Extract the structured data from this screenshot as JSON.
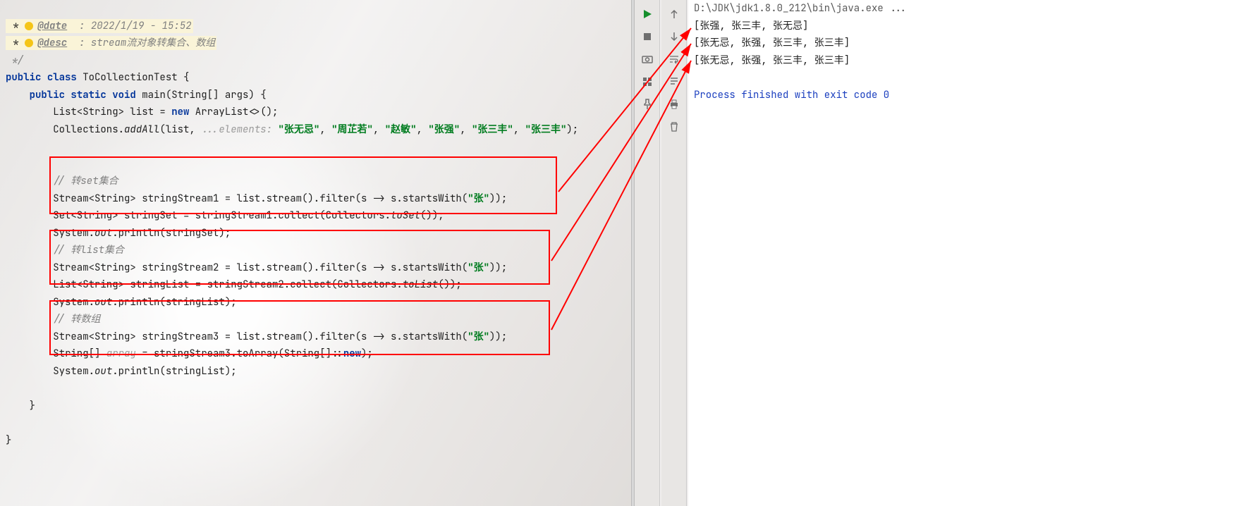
{
  "javadoc": {
    "date_tag": "@date",
    "date_val": ": 2022/1/19 - 15:52",
    "desc_tag": "@desc",
    "desc_val": ": stream流对象转集合、数组",
    "end": "*/"
  },
  "code": {
    "l1": {
      "kw1": "public",
      "kw2": "class",
      "name": "ToCollectionTest {"
    },
    "l2": {
      "kw1": "public",
      "kw2": "static",
      "kw3": "void",
      "sig": "main(String[] args) {"
    },
    "l3": {
      "a": "List<String> list = ",
      "kw": "new",
      "b": " ArrayList<>();"
    },
    "l4": {
      "a": "Collections.",
      "m": "addAll",
      "b": "(list, ",
      "hint": "...elements: ",
      "s1": "\"张无忌\"",
      "s2": "\"周芷若\"",
      "s3": "\"赵敏\"",
      "s4": "\"张强\"",
      "s5": "\"张三丰\"",
      "s6": "\"张三丰\"",
      "end": ");"
    },
    "c1": "// 转set集合",
    "l5": {
      "a": "Stream<String> stringStream1 = list.stream().filter(s -> s.startsWith(",
      "s": "\"张\"",
      "b": "));"
    },
    "l6": {
      "a": "Set<String> stringSet = stringStream1.collect(Collectors.",
      "m": "toSet",
      "b": "());"
    },
    "l7": {
      "a": "System.",
      "f": "out",
      "b": ".println(stringSet);"
    },
    "c2": "// 转list集合",
    "l8": {
      "a": "Stream<String> stringStream2 = list.stream().filter(s -> s.startsWith(",
      "s": "\"张\"",
      "b": "));"
    },
    "l9": {
      "a": "List<String> stringList = stringStream2.collect(Collectors.",
      "m": "toList",
      "b": "());"
    },
    "l10": {
      "a": "System.",
      "f": "out",
      "b": ".println(stringList);"
    },
    "c3": "// 转数组",
    "l11": {
      "a": "Stream<String> stringStream3 = list.stream().filter(s -> s.startsWith(",
      "s": "\"张\"",
      "b": "));"
    },
    "l12": {
      "a": "String[] ",
      "h": "array",
      "b": " = stringStream3.toArray(String[]::",
      "kw": "new",
      "c": ");"
    },
    "l13": {
      "a": "System.",
      "f": "out",
      "b": ".println(stringList);"
    },
    "close1": "    }",
    "close2": "}"
  },
  "output": {
    "cmd": "D:\\JDK\\jdk1.8.0_212\\bin\\java.exe ...",
    "line1": "[张强, 张三丰, 张无忌]",
    "line2": "[张无忌, 张强, 张三丰, 张三丰]",
    "line3": "[张无忌, 张强, 张三丰, 张三丰]",
    "exit": "Process finished with exit code 0"
  }
}
